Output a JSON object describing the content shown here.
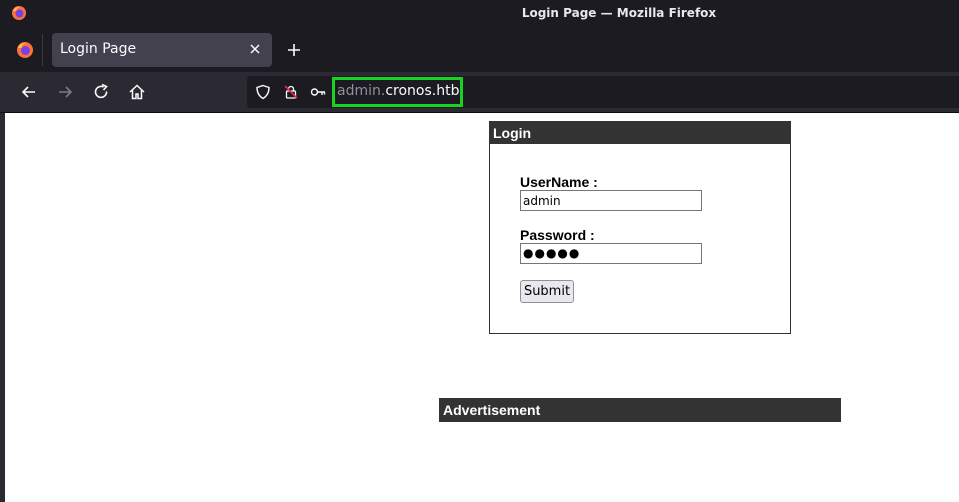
{
  "window": {
    "title": "Login Page — Mozilla Firefox"
  },
  "tabs": [
    {
      "title": "Login Page"
    }
  ],
  "urlbar": {
    "subdomain": "admin.",
    "domain": "cronos.htb"
  },
  "login": {
    "header": "Login",
    "username_label": "UserName :",
    "username_value": "admin",
    "password_label": "Password :",
    "password_mask": "●●●●●",
    "submit_label": "Submit"
  },
  "advert": {
    "header": "Advertisement"
  },
  "icons": {
    "firefox": "firefox-logo-icon",
    "close": "close-icon",
    "new_tab": "plus-icon",
    "back": "back-arrow-icon",
    "forward": "forward-arrow-icon",
    "reload": "reload-icon",
    "home": "home-icon",
    "shield": "shield-icon",
    "insecure_lock": "insecure-lock-icon",
    "key": "key-icon"
  },
  "colors": {
    "highlight": "#19d11f",
    "chrome_dark": "#1c1b22",
    "toolbar": "#2b2a33",
    "header_bar": "#333333"
  }
}
